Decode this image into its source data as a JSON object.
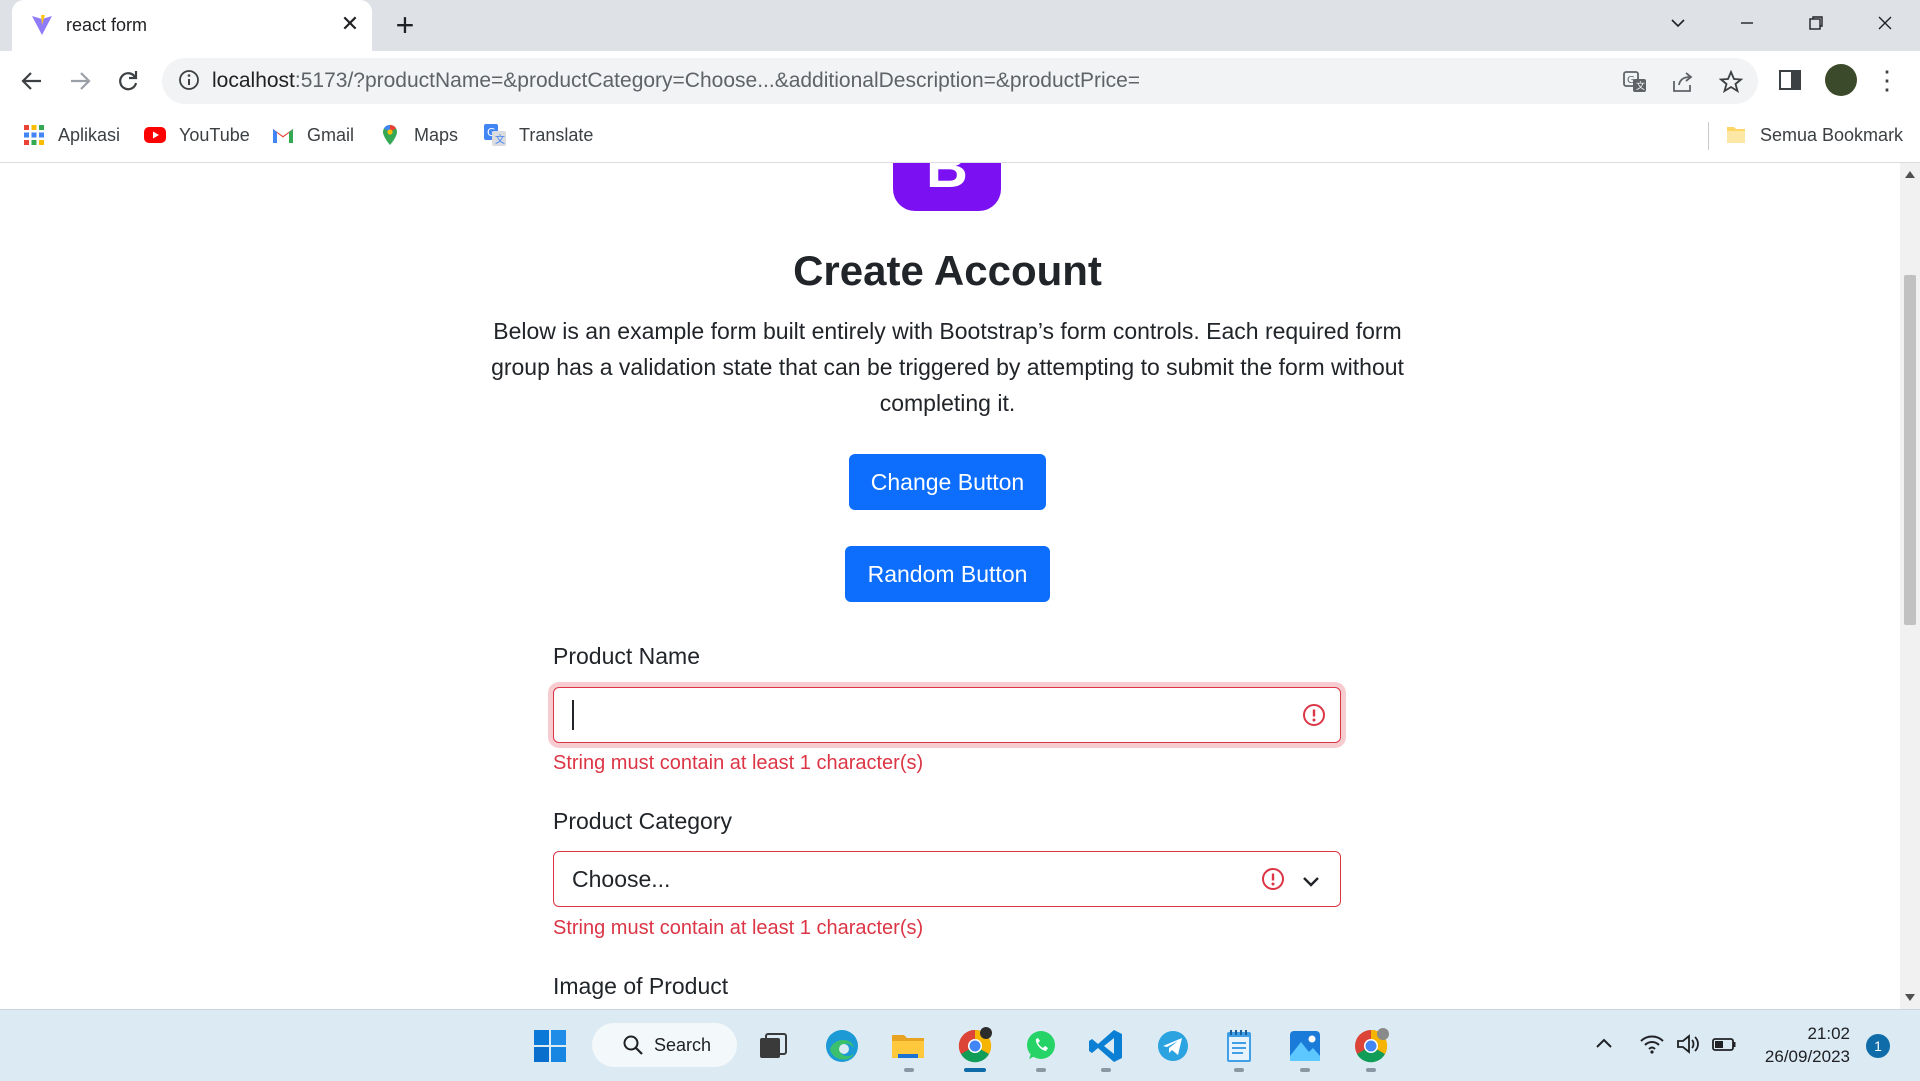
{
  "browser": {
    "tab_title": "react form",
    "url_host": "localhost",
    "url_rest": ":5173/?productName=&productCategory=Choose...&additionalDescription=&productPrice=",
    "bookmarks": [
      {
        "label": "Aplikasi",
        "icon": "apps-grid-icon"
      },
      {
        "label": "YouTube",
        "icon": "youtube-icon"
      },
      {
        "label": "Gmail",
        "icon": "gmail-icon"
      },
      {
        "label": "Maps",
        "icon": "maps-icon"
      },
      {
        "label": "Translate",
        "icon": "translate-icon"
      }
    ],
    "all_bookmarks_label": "Semua Bookmark"
  },
  "page": {
    "logo_letter": "B",
    "title": "Create Account",
    "lead": "Below is an example form built entirely with Bootstrap’s form controls. Each required form group has a validation state that can be triggered by attempting to submit the form without completing it.",
    "change_button": "Change Button",
    "random_button": "Random Button",
    "product_name_label": "Product Name",
    "product_name_value": "",
    "product_name_error": "String must contain at least 1 character(s)",
    "product_category_label": "Product Category",
    "product_category_value": "Choose...",
    "product_category_error": "String must contain at least 1 character(s)",
    "image_label": "Image of Product"
  },
  "colors": {
    "primary": "#0d6efd",
    "danger": "#dc3545",
    "bootstrap_purple": "#7b10f2"
  },
  "taskbar": {
    "search_label": "Search",
    "time": "21:02",
    "date": "26/09/2023",
    "notification_count": "1"
  }
}
